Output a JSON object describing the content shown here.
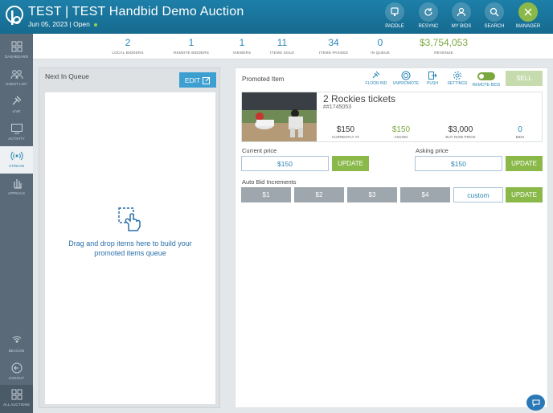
{
  "header": {
    "title": "TEST | TEST Handbid Demo Auction",
    "date": "Jun 05, 2023",
    "separator": " | ",
    "status": "Open",
    "buttons": [
      {
        "label": "PADDLE",
        "icon": "paddle-icon"
      },
      {
        "label": "RESYNC",
        "icon": "resync-icon"
      },
      {
        "label": "MY BIDS",
        "icon": "user-icon"
      },
      {
        "label": "SEARCH",
        "icon": "search-icon"
      },
      {
        "label": "MANAGER",
        "icon": "close-icon"
      }
    ]
  },
  "sidebar": {
    "items": [
      {
        "label": "DASHBOARD",
        "icon": "dashboard-icon"
      },
      {
        "label": "GUEST LIST",
        "icon": "guests-icon"
      },
      {
        "label": "LIVE",
        "icon": "gavel-icon"
      },
      {
        "label": "ACTIVITY",
        "icon": "monitor-icon"
      },
      {
        "label": "STREAM",
        "icon": "broadcast-icon"
      },
      {
        "label": "APPEALS",
        "icon": "hand-icon"
      },
      {
        "label": "BEACON",
        "icon": "beacon-icon"
      },
      {
        "label": "LOGOUT",
        "icon": "logout-icon"
      },
      {
        "label": "ALL AUCTIONS",
        "icon": "grid-icon"
      }
    ]
  },
  "stats": [
    {
      "value": "2",
      "label": "LOCAL BIDDERS"
    },
    {
      "value": "1",
      "label": "REMOTE BIDDERS"
    },
    {
      "value": "1",
      "label": "VIEWERS"
    },
    {
      "value": "11",
      "label": "ITEMS SOLD"
    },
    {
      "value": "34",
      "label": "ITEMS PASSED"
    },
    {
      "value": "0",
      "label": "IN QUEUE"
    },
    {
      "value": "$3,754,053",
      "label": "REVENUE"
    }
  ],
  "queue": {
    "title": "Next In Queue",
    "edit_label": "EDIT",
    "empty_text": "Drag and drop items here to build your promoted items queue"
  },
  "promoted": {
    "title": "Promoted Item",
    "actions": [
      {
        "label": "FLOOR BID",
        "icon": "gavel-icon"
      },
      {
        "label": "UNPROMOTE",
        "icon": "unpromote-icon"
      },
      {
        "label": "PUSH",
        "icon": "push-icon"
      },
      {
        "label": "SETTINGS",
        "icon": "gear-icon"
      },
      {
        "label": "REMOTE BIDS",
        "icon": "toggle-icon"
      }
    ],
    "sell_label": "SELL",
    "item": {
      "name": "2 Rockies tickets",
      "number": "##1745053",
      "stats": [
        {
          "value": "$150",
          "label": "CURRENTLY AT"
        },
        {
          "value": "$150",
          "label": "ASKING"
        },
        {
          "value": "$3,000",
          "label": "BUY NOW PRICE"
        },
        {
          "value": "0",
          "label": "BIDS"
        }
      ]
    },
    "current_price": {
      "label": "Current price",
      "value": "$150",
      "button": "UPDATE"
    },
    "asking_price": {
      "label": "Asking price",
      "value": "$150",
      "button": "UPDATE"
    },
    "increments": {
      "label": "Auto Bid Increments",
      "options": [
        "$1",
        "$2",
        "$3",
        "$4"
      ],
      "custom_placeholder": "custom",
      "button": "UPDATE"
    }
  },
  "colors": {
    "header": "#1d7fa8",
    "accent_blue": "#2a86b4",
    "accent_green": "#8ab94a",
    "sidebar": "#5a6a78"
  }
}
